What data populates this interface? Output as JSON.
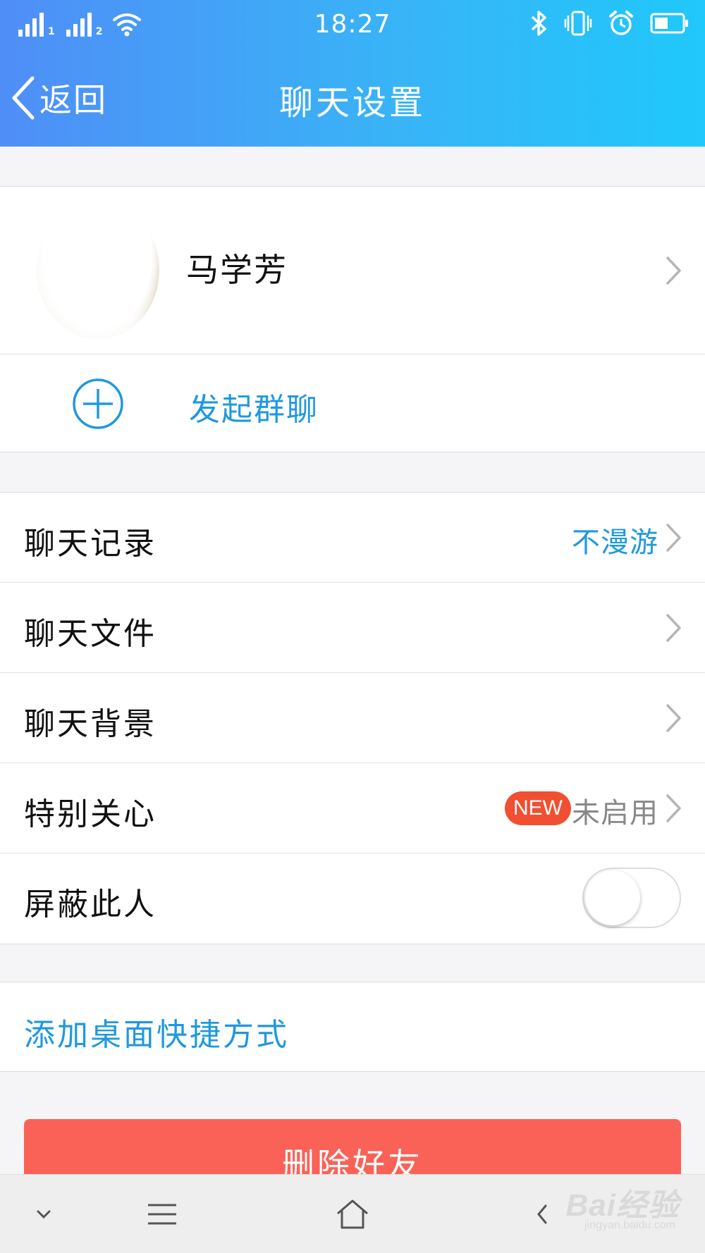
{
  "status_bar": {
    "time": "18:27",
    "sim1": "1",
    "sim2": "2",
    "icons": [
      "signal-icon",
      "wifi-icon",
      "bluetooth-icon",
      "vibrate-icon",
      "alarm-icon",
      "battery-icon"
    ]
  },
  "nav": {
    "back_label": "返回",
    "title": "聊天设置"
  },
  "profile": {
    "name": "马学芳"
  },
  "group_chat": {
    "label": "发起群聊"
  },
  "settings": {
    "chat_history": {
      "label": "聊天记录",
      "value": "不漫游"
    },
    "chat_files": {
      "label": "聊天文件"
    },
    "chat_background": {
      "label": "聊天背景"
    },
    "special_care": {
      "label": "特别关心",
      "badge": "NEW",
      "value": "未启用"
    },
    "block_person": {
      "label": "屏蔽此人",
      "enabled": false
    }
  },
  "shortcut": {
    "label": "添加桌面快捷方式"
  },
  "delete_button": {
    "label": "删除好友"
  },
  "system_nav": {
    "icons": [
      "collapse-icon",
      "menu-icon",
      "home-icon",
      "back-icon"
    ]
  },
  "watermark": {
    "main": "Bai经验",
    "sub": "jingyan.baidu.com"
  },
  "colors": {
    "header_start": "#4f8ef7",
    "header_end": "#20c8fb",
    "accent_blue": "#1f98e0",
    "delete_red": "#fa6257",
    "badge_red": "#f14f32"
  }
}
